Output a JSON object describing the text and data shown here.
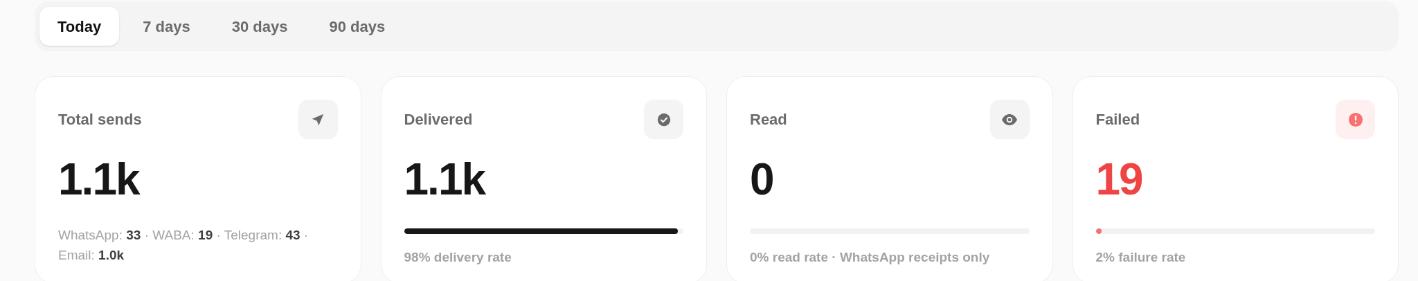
{
  "tabs": [
    {
      "label": "Today",
      "selected": true
    },
    {
      "label": "7 days",
      "selected": false
    },
    {
      "label": "30 days",
      "selected": false
    },
    {
      "label": "90 days",
      "selected": false
    }
  ],
  "cards": [
    {
      "kind": "breakdown",
      "title": "Total sends",
      "value": "1.1k",
      "color": "#171717",
      "note": "WhatsApp: **33** · WABA: **19** · Telegram: **43** · Email: **1.0k**"
    },
    {
      "kind": "meter",
      "title": "Delivered",
      "value": "1.1k",
      "color": "#171717",
      "level": 0.98,
      "note": "98% delivery rate"
    },
    {
      "kind": "meter",
      "title": "Read",
      "value": "0",
      "color": "#171717",
      "level": 0,
      "note": "0% read rate · WhatsApp receipts only"
    },
    {
      "kind": "meter",
      "title": "Failed",
      "value": "19",
      "color": "#ef4444",
      "level": 0.02,
      "note": "2% failure rate"
    }
  ]
}
